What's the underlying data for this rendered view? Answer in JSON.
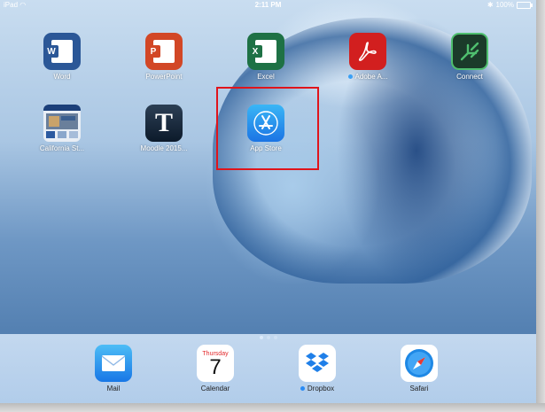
{
  "status_bar": {
    "device": "iPad",
    "time": "2:11 PM",
    "battery": "100%"
  },
  "home_apps": [
    {
      "name": "Word",
      "tag": "W"
    },
    {
      "name": "PowerPoint",
      "tag": "P"
    },
    {
      "name": "Excel",
      "tag": "X"
    },
    {
      "name": "Adobe A..."
    },
    {
      "name": "Connect"
    },
    {
      "name": "California St..."
    },
    {
      "name": "Moodle 2015...",
      "tag": "T"
    },
    {
      "name": "App Store"
    }
  ],
  "dock_apps": [
    {
      "name": "Mail"
    },
    {
      "name": "Calendar",
      "day_name": "Thursday",
      "day_number": "7"
    },
    {
      "name": "Dropbox"
    },
    {
      "name": "Safari"
    }
  ],
  "page_indicator": {
    "pages": 3,
    "current": 1
  }
}
